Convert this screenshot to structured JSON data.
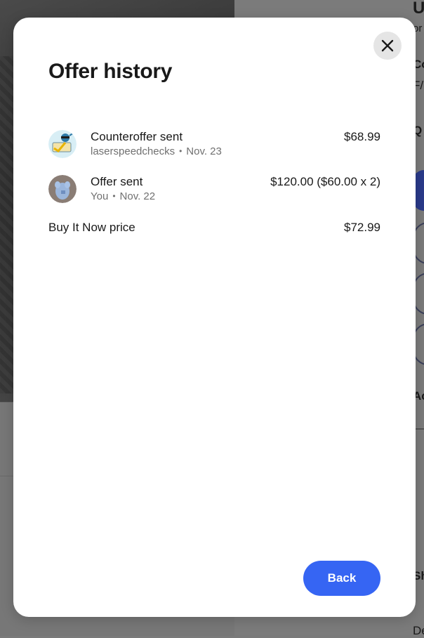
{
  "background": {
    "peek_texts": [
      "U",
      "or",
      "Co",
      "F/",
      "Q",
      "Ac",
      "Sh",
      "De"
    ]
  },
  "modal": {
    "title": "Offer history",
    "close_icon": "close-icon",
    "entries": [
      {
        "title": "Counteroffer sent",
        "user": "laserspeedchecks",
        "date": "Nov. 23",
        "amount": "$68.99",
        "avatar_icon": "seller-avatar-icon"
      },
      {
        "title": "Offer sent",
        "user": "You",
        "date": "Nov. 22",
        "amount": "$120.00 ($60.00 x 2)",
        "avatar_icon": "buyer-avatar-icon"
      }
    ],
    "buy_it_now": {
      "label": "Buy It Now price",
      "price": "$72.99"
    },
    "back_label": "Back",
    "colors": {
      "primary_button": "#3665f3",
      "close_button_bg": "#e5e5e5"
    }
  }
}
